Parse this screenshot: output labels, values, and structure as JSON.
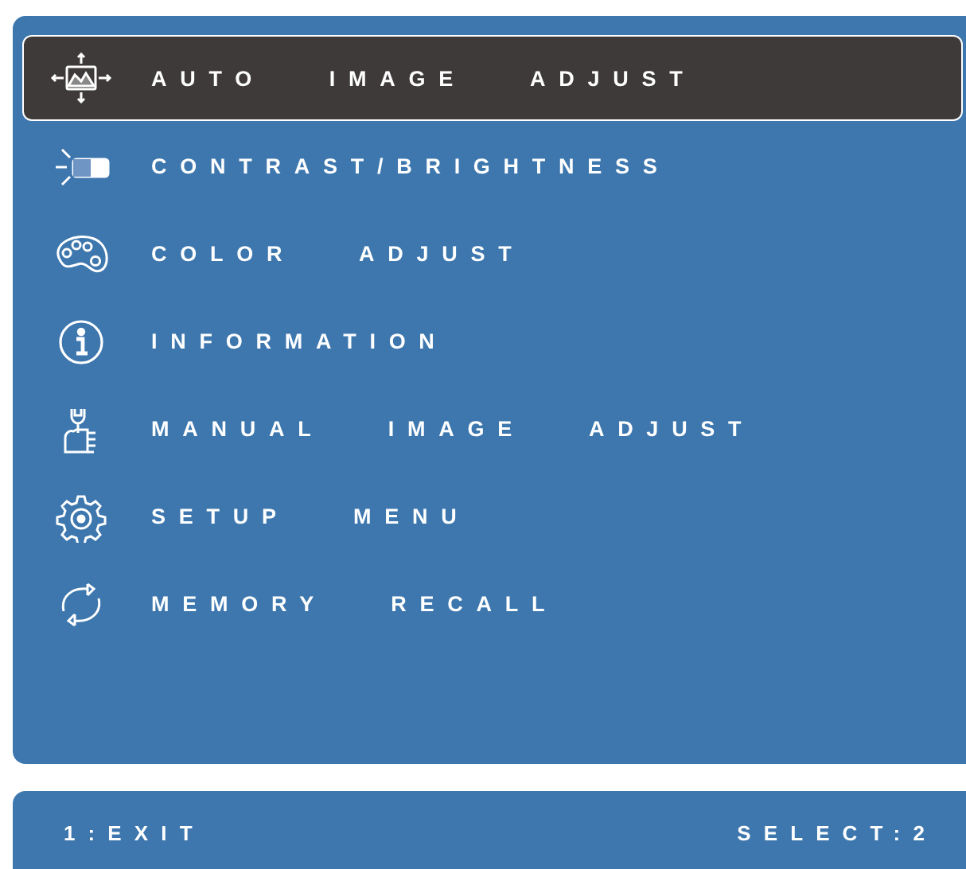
{
  "menu": {
    "items": [
      {
        "label": "AUTO IMAGE ADJUST",
        "selected": true
      },
      {
        "label": "CONTRAST/BRIGHTNESS",
        "selected": false
      },
      {
        "label": "COLOR ADJUST",
        "selected": false
      },
      {
        "label": "INFORMATION",
        "selected": false
      },
      {
        "label": "MANUAL IMAGE ADJUST",
        "selected": false
      },
      {
        "label": "SETUP MENU",
        "selected": false
      },
      {
        "label": "MEMORY RECALL",
        "selected": false
      }
    ]
  },
  "footer": {
    "left": "1:EXIT",
    "right": "SELECT:2"
  }
}
